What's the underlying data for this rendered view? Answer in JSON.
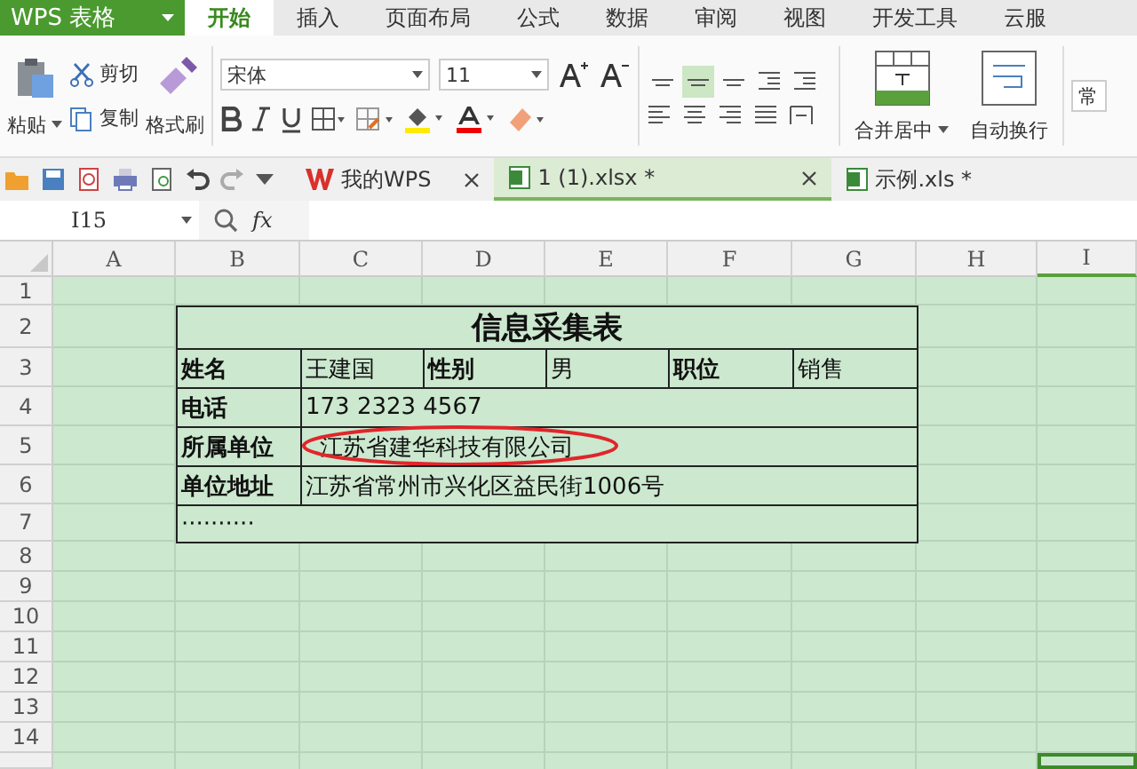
{
  "app_menu": {
    "label": "WPS 表格"
  },
  "menu_tabs": [
    {
      "label": "开始",
      "selected": true
    },
    {
      "label": "插入",
      "selected": false
    },
    {
      "label": "页面布局",
      "selected": false
    },
    {
      "label": "公式",
      "selected": false
    },
    {
      "label": "数据",
      "selected": false
    },
    {
      "label": "审阅",
      "selected": false
    },
    {
      "label": "视图",
      "selected": false
    },
    {
      "label": "开发工具",
      "selected": false
    },
    {
      "label": "云服",
      "selected": false
    }
  ],
  "ribbon": {
    "paste": "粘贴",
    "cut": "剪切",
    "copy": "复制",
    "format_painter": "格式刷",
    "font": "宋体",
    "font_size": "11",
    "merge": "合并居中",
    "wrap": "自动换行",
    "style_field": "常",
    "align_buttons": [
      {
        "selected": false
      },
      {
        "selected": true
      },
      {
        "selected": false
      },
      {
        "selected": false
      },
      {
        "selected": false
      }
    ]
  },
  "doc_tabs": [
    {
      "label": "我的WPS",
      "kind": "home",
      "selected": false,
      "closable": true
    },
    {
      "label": "1 (1).xlsx *",
      "kind": "sheet",
      "selected": true,
      "closable": true
    },
    {
      "label": "示例.xls *",
      "kind": "sheet",
      "selected": false,
      "closable": false
    }
  ],
  "formula_bar": {
    "name_box": "I15",
    "fx": "fx"
  },
  "columns": [
    {
      "label": "A",
      "selected": false
    },
    {
      "label": "B",
      "selected": false
    },
    {
      "label": "C",
      "selected": false
    },
    {
      "label": "D",
      "selected": false
    },
    {
      "label": "E",
      "selected": false
    },
    {
      "label": "F",
      "selected": false
    },
    {
      "label": "G",
      "selected": false
    },
    {
      "label": "H",
      "selected": false
    },
    {
      "label": "I",
      "selected": true
    }
  ],
  "row_numbers": [
    "1",
    "2",
    "3",
    "4",
    "5",
    "6",
    "7",
    "8",
    "9",
    "10",
    "11",
    "12",
    "13",
    "14"
  ],
  "table": {
    "title": "信息采集表",
    "rows": [
      {
        "kind": "pairs",
        "cells": [
          "姓名",
          "王建国",
          "性别",
          "男",
          "职位",
          "销售"
        ]
      },
      {
        "kind": "field",
        "cells": [
          "电话",
          "173 2323 4567"
        ]
      },
      {
        "kind": "field",
        "cells": [
          "所属单位",
          "江苏省建华科技有限公司"
        ],
        "circled": true
      },
      {
        "kind": "field",
        "cells": [
          "单位地址",
          "江苏省常州市兴化区益民街1006号"
        ]
      },
      {
        "kind": "more",
        "cells": [
          "··········"
        ]
      }
    ]
  }
}
